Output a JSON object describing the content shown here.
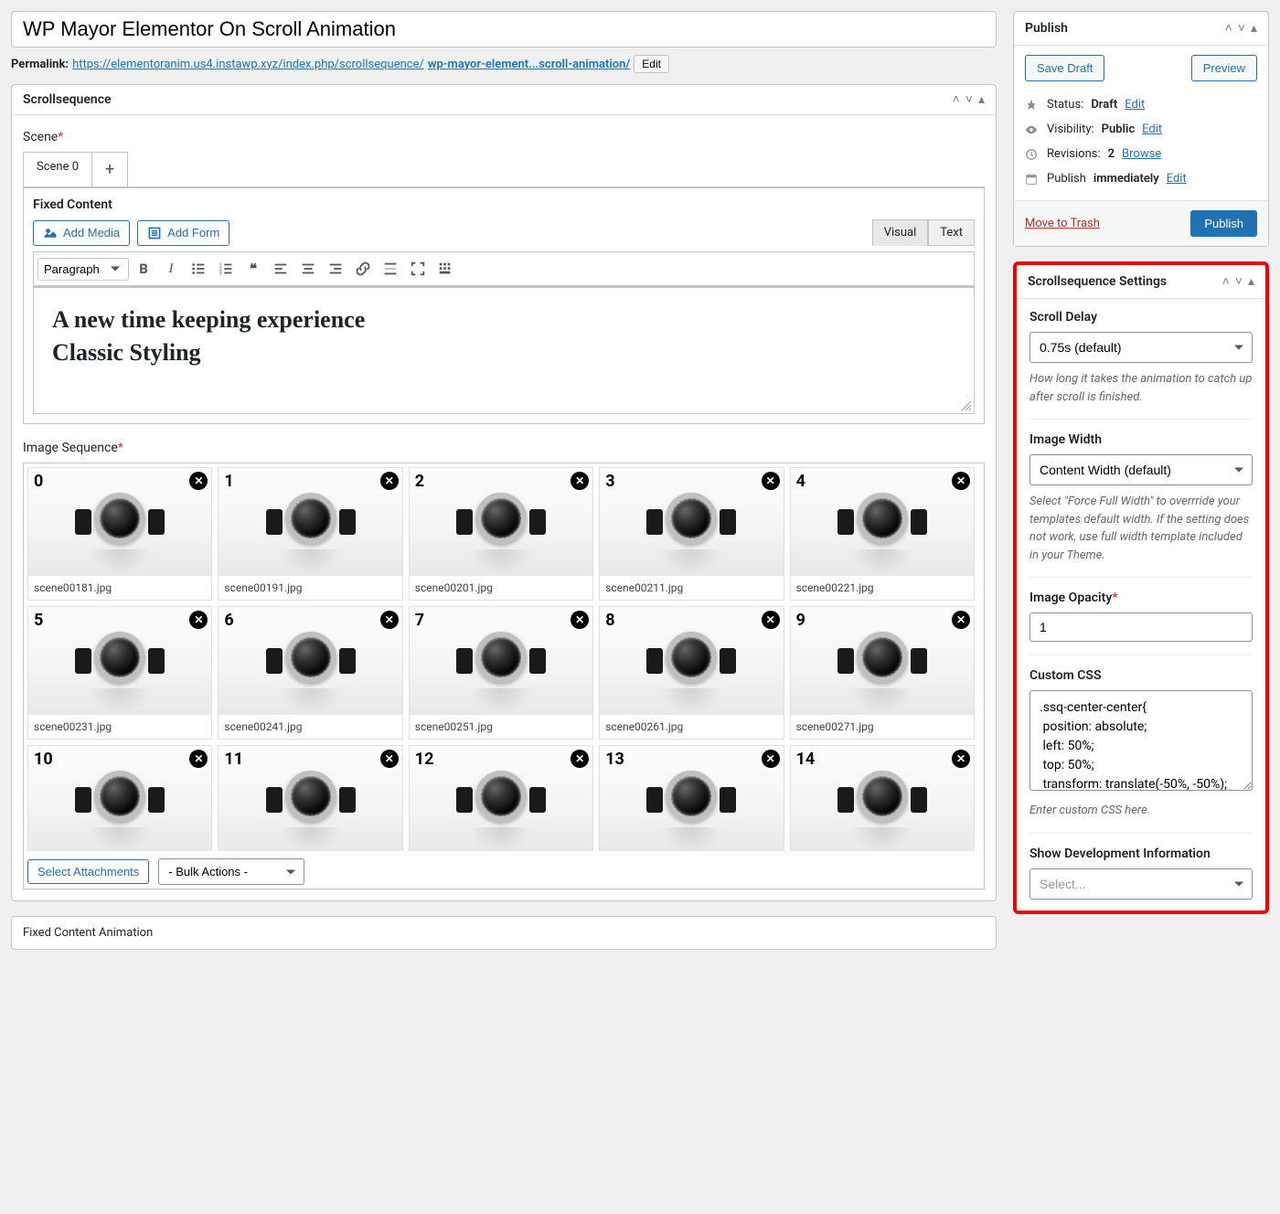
{
  "title": "WP Mayor Elementor On Scroll Animation",
  "permalink": {
    "label": "Permalink:",
    "base_url": "https://elementoranim.us4.instawp.xyz/index.php/scrollsequence/",
    "slug": "wp-mayor-element...scroll-animation/",
    "edit": "Edit"
  },
  "scrollsequence_panel": {
    "title": "Scrollsequence",
    "scene_label": "Scene",
    "tabs": {
      "scene0": "Scene 0",
      "add": "+"
    },
    "fixed_content_label": "Fixed Content",
    "add_media": "Add Media",
    "add_form": "Add Form",
    "editor_tabs": {
      "visual": "Visual",
      "text": "Text"
    },
    "format_select": "Paragraph",
    "content_h1": "A new time keeping experience",
    "content_h2": "Classic Styling",
    "image_sequence_label": "Image Sequence",
    "images": [
      {
        "idx": "0",
        "file": "scene00181.jpg"
      },
      {
        "idx": "1",
        "file": "scene00191.jpg"
      },
      {
        "idx": "2",
        "file": "scene00201.jpg"
      },
      {
        "idx": "3",
        "file": "scene00211.jpg"
      },
      {
        "idx": "4",
        "file": "scene00221.jpg"
      },
      {
        "idx": "5",
        "file": "scene00231.jpg"
      },
      {
        "idx": "6",
        "file": "scene00241.jpg"
      },
      {
        "idx": "7",
        "file": "scene00251.jpg"
      },
      {
        "idx": "8",
        "file": "scene00261.jpg"
      },
      {
        "idx": "9",
        "file": "scene00271.jpg"
      },
      {
        "idx": "10",
        "file": ""
      },
      {
        "idx": "11",
        "file": ""
      },
      {
        "idx": "12",
        "file": ""
      },
      {
        "idx": "13",
        "file": ""
      },
      {
        "idx": "14",
        "file": ""
      }
    ],
    "select_attachments": "Select Attachments",
    "bulk_actions": "- Bulk Actions -",
    "fixed_content_anim": "Fixed Content Animation"
  },
  "publish": {
    "title": "Publish",
    "save_draft": "Save Draft",
    "preview": "Preview",
    "status_label": "Status:",
    "status_value": "Draft",
    "visibility_label": "Visibility:",
    "visibility_value": "Public",
    "revisions_label": "Revisions:",
    "revisions_count": "2",
    "browse": "Browse",
    "edit": "Edit",
    "publish_label": "Publish",
    "publish_value": "immediately",
    "trash": "Move to Trash",
    "publish_btn": "Publish"
  },
  "settings": {
    "title": "Scrollsequence Settings",
    "scroll_delay_label": "Scroll Delay",
    "scroll_delay_value": "0.75s (default)",
    "scroll_delay_help": "How long it takes the animation to catch up after scroll is finished.",
    "image_width_label": "Image Width",
    "image_width_value": "Content Width (default)",
    "image_width_help": "Select \"Force Full Width\" to overrride your templates default width. If the setting does not work, use full width template included in your Theme.",
    "image_opacity_label": "Image Opacity",
    "image_opacity_value": "1",
    "custom_css_label": "Custom CSS",
    "custom_css_value": ".ssq-center-center{\n position: absolute;\n left: 50%;\n top: 50%;\n transform: translate(-50%, -50%);",
    "custom_css_help": "Enter custom CSS here.",
    "show_dev_label": "Show Development Information",
    "show_dev_placeholder": "Select..."
  }
}
